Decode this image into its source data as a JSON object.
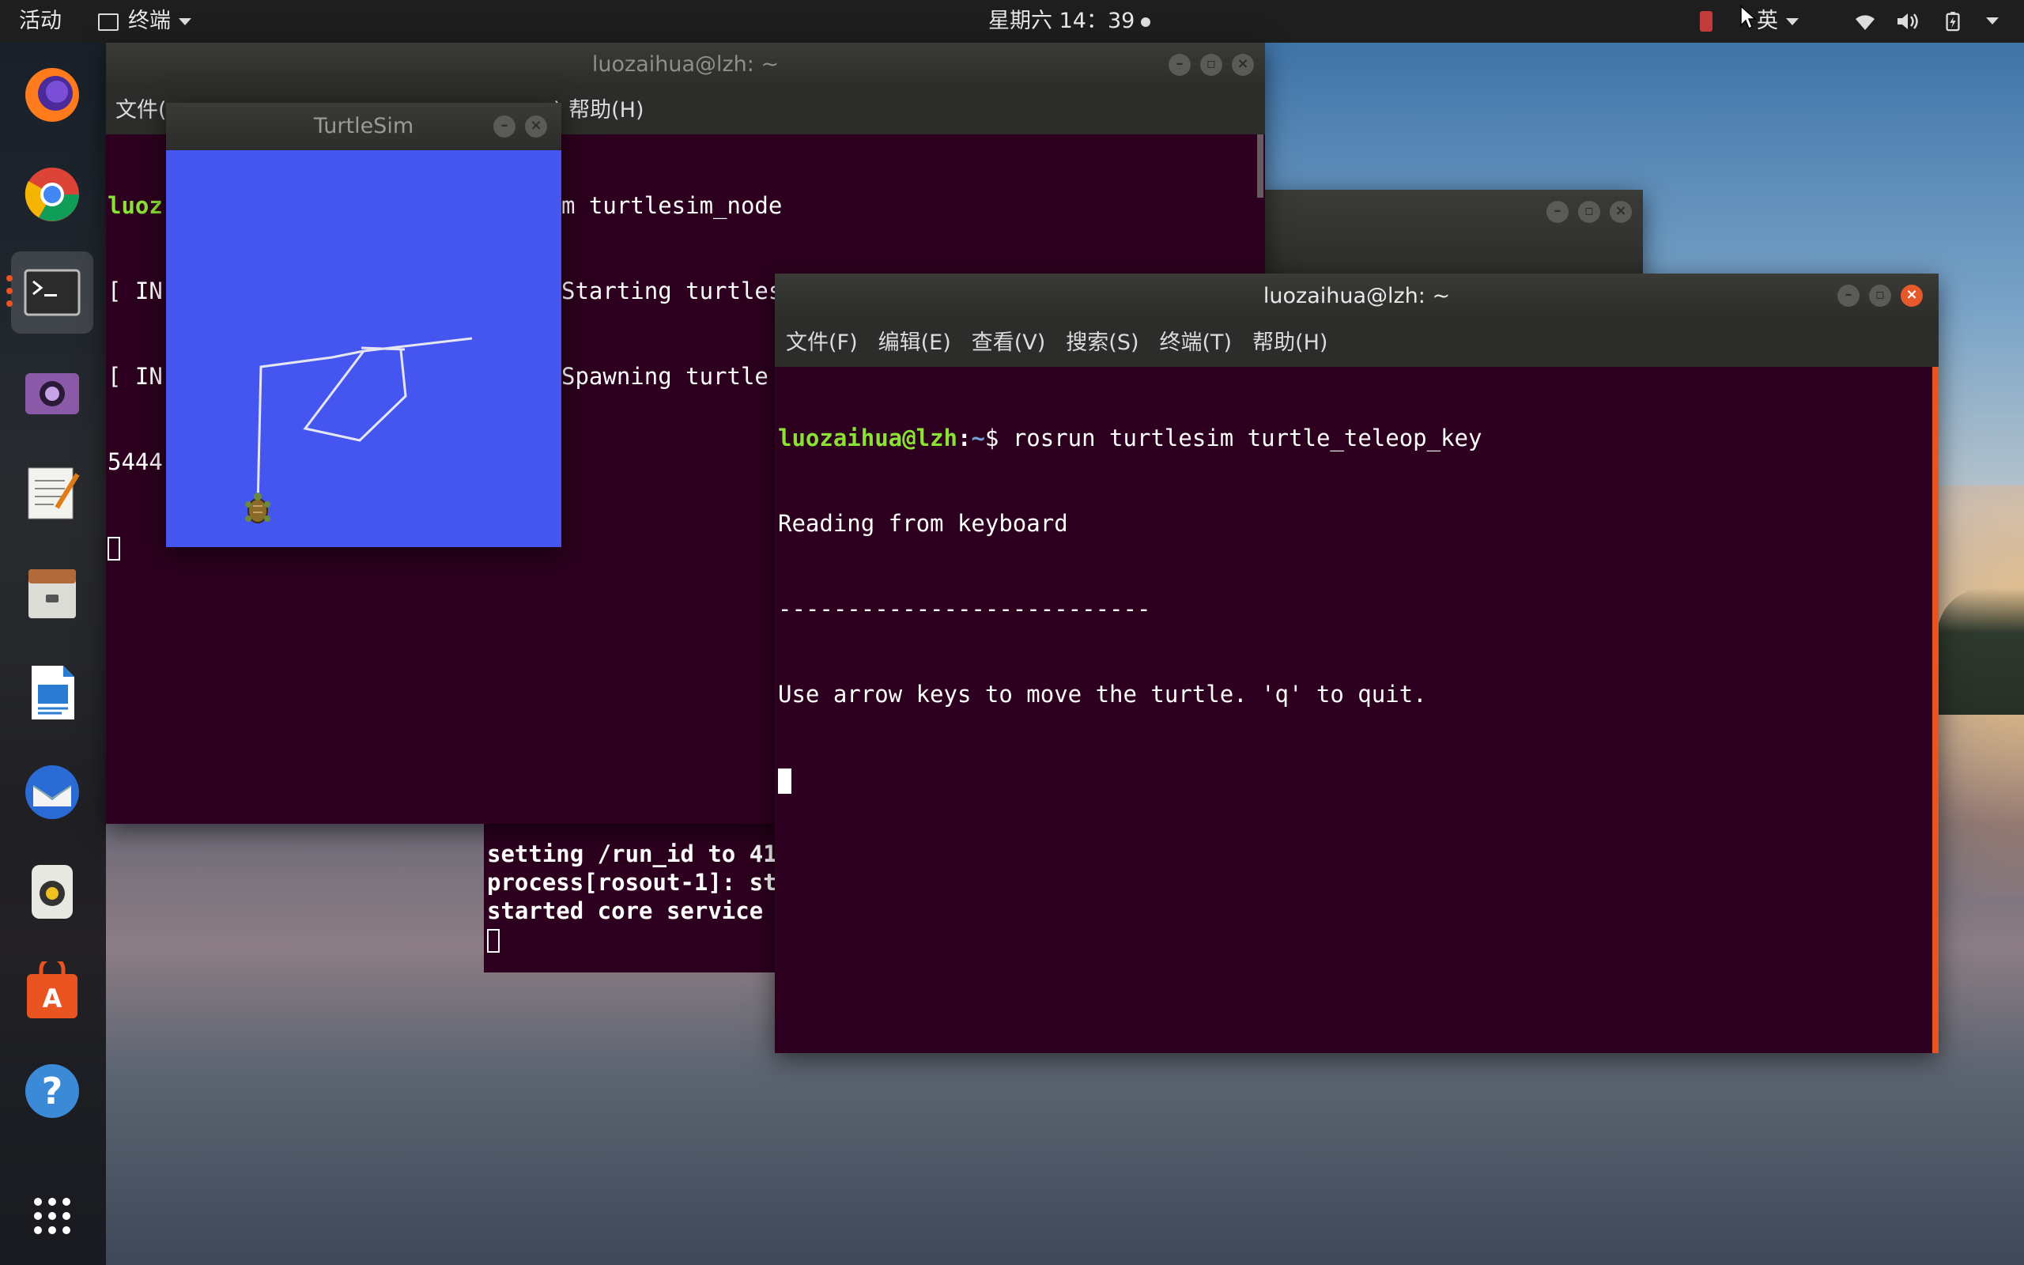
{
  "topbar": {
    "activities": "活动",
    "app_menu": "终端",
    "clock": "星期六 14：39",
    "input_method": "英"
  },
  "dock": {
    "items": [
      {
        "name": "firefox",
        "icon": "firefox-icon"
      },
      {
        "name": "chrome",
        "icon": "chrome-icon"
      },
      {
        "name": "terminal",
        "icon": "terminal-icon"
      },
      {
        "name": "cheese",
        "icon": "camera-icon"
      },
      {
        "name": "text-editor",
        "icon": "text-editor-icon"
      },
      {
        "name": "files",
        "icon": "file-cabinet-icon"
      },
      {
        "name": "writer",
        "icon": "document-icon"
      },
      {
        "name": "thunderbird",
        "icon": "mail-icon"
      },
      {
        "name": "rhythmbox",
        "icon": "speaker-icon"
      },
      {
        "name": "software",
        "icon": "software-center-icon"
      },
      {
        "name": "help",
        "icon": "help-icon"
      },
      {
        "name": "show-apps",
        "icon": "app-grid-icon"
      }
    ]
  },
  "back_terminal": {
    "title": "luozaihua@lzh: ~",
    "menu_left": "文件(",
    "menu_right": ")  帮助(H)",
    "lines_left": [
      "luoz",
      "[ IN",
      "[ IN",
      "5444"
    ],
    "lines_right": [
      "m turtlesim_node",
      "Starting turtlesim with node name /turtlesim",
      "Spawning turtle [turtle1] at x=[5.544445], y=[5."
    ]
  },
  "turtlesim": {
    "title": "TurtleSim",
    "background": "#4556f0"
  },
  "roscore_terminal": {
    "lines": [
      "setting /run_id to 41",
      "process[rosout-1]: st",
      "started core service"
    ]
  },
  "front_terminal": {
    "title": "luozaihua@lzh: ~",
    "menu": [
      "文件(F)",
      "编辑(E)",
      "查看(V)",
      "搜索(S)",
      "终端(T)",
      "帮助(H)"
    ],
    "prompt_user": "luozaihua@lzh",
    "prompt_path": "~",
    "command": "rosrun turtlesim turtle_teleop_key",
    "output": [
      "Reading from keyboard",
      "---------------------------",
      "Use arrow keys to move the turtle. 'q' to quit."
    ]
  }
}
